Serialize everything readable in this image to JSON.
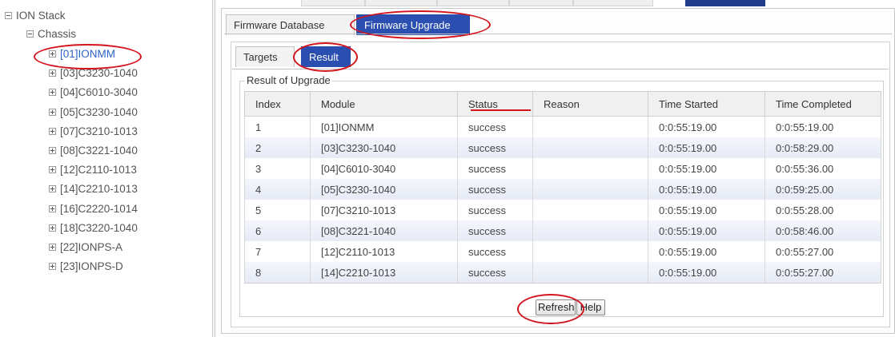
{
  "tree": {
    "root": "ION Stack",
    "chassis": "Chassis",
    "modules": [
      "[01]IONMM",
      "[03]C3230-1040",
      "[04]C6010-3040",
      "[05]C3230-1040",
      "[07]C3210-1013",
      "[08]C3221-1040",
      "[12]C2110-1013",
      "[14]C2210-1013",
      "[16]C2220-1014",
      "[18]C3220-1040",
      "[22]IONPS-A",
      "[23]IONPS-D"
    ],
    "selected_index": 0
  },
  "tabs": {
    "main": [
      "Firmware Database",
      "Firmware Upgrade"
    ],
    "main_active": 1,
    "sub": [
      "Targets",
      "Result"
    ],
    "sub_active": 1
  },
  "results": {
    "legend": "Result of Upgrade",
    "columns": [
      "Index",
      "Module",
      "Status",
      "Reason",
      "Time Started",
      "Time Completed"
    ],
    "rows": [
      [
        "1",
        "[01]IONMM",
        "success",
        "",
        "0:0:55:19.00",
        "0:0:55:19.00"
      ],
      [
        "2",
        "[03]C3230-1040",
        "success",
        "",
        "0:0:55:19.00",
        "0:0:58:29.00"
      ],
      [
        "3",
        "[04]C6010-3040",
        "success",
        "",
        "0:0:55:19.00",
        "0:0:55:36.00"
      ],
      [
        "4",
        "[05]C3230-1040",
        "success",
        "",
        "0:0:55:19.00",
        "0:0:59:25.00"
      ],
      [
        "5",
        "[07]C3210-1013",
        "success",
        "",
        "0:0:55:19.00",
        "0:0:55:28.00"
      ],
      [
        "6",
        "[08]C3221-1040",
        "success",
        "",
        "0:0:55:19.00",
        "0:0:58:46.00"
      ],
      [
        "7",
        "[12]C2110-1013",
        "success",
        "",
        "0:0:55:19.00",
        "0:0:55:27.00"
      ],
      [
        "8",
        "[14]C2210-1013",
        "success",
        "",
        "0:0:55:19.00",
        "0:0:55:27.00"
      ]
    ]
  },
  "buttons": {
    "refresh": "Refresh",
    "help": "Help"
  },
  "colors": {
    "annotation": "#d3141d",
    "active_tab": "#2a4fb0",
    "selected_tree": "#2b63c9"
  },
  "icons": {
    "expanded": "minus-box-icon",
    "collapsed": "plus-box-icon"
  }
}
